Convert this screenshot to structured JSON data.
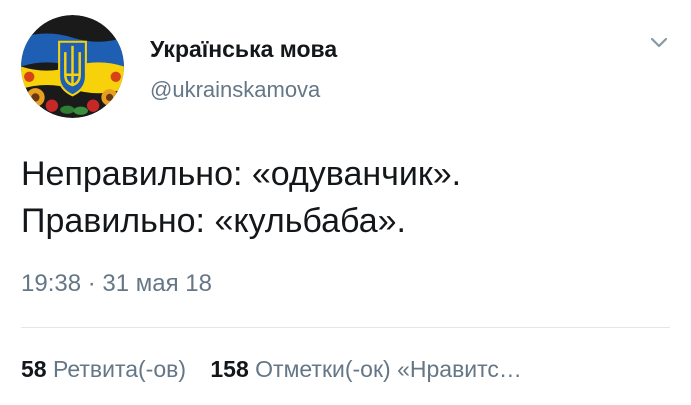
{
  "profile": {
    "display_name": "Українська мова",
    "handle": "@ukrainskamova",
    "avatar_icon": "ukrainian-trident-wreath-avatar"
  },
  "menu": {
    "icon": "chevron-down-icon"
  },
  "tweet": {
    "lines": [
      "Неправильно: «одуванчик».",
      "Правильно: «кульбаба»."
    ],
    "timestamp": "19:38 · 31 мая 18"
  },
  "stats": {
    "retweets_count": "58",
    "retweets_label": "Ретвита(-ов)",
    "likes_count": "158",
    "likes_label": "Отметки(-ок) «Нравитс…"
  },
  "colors": {
    "text_primary": "#14171a",
    "text_secondary": "#657786",
    "divider": "#e1e8ed",
    "flag_blue": "#1e5fb4",
    "flag_yellow": "#f7d20b"
  }
}
